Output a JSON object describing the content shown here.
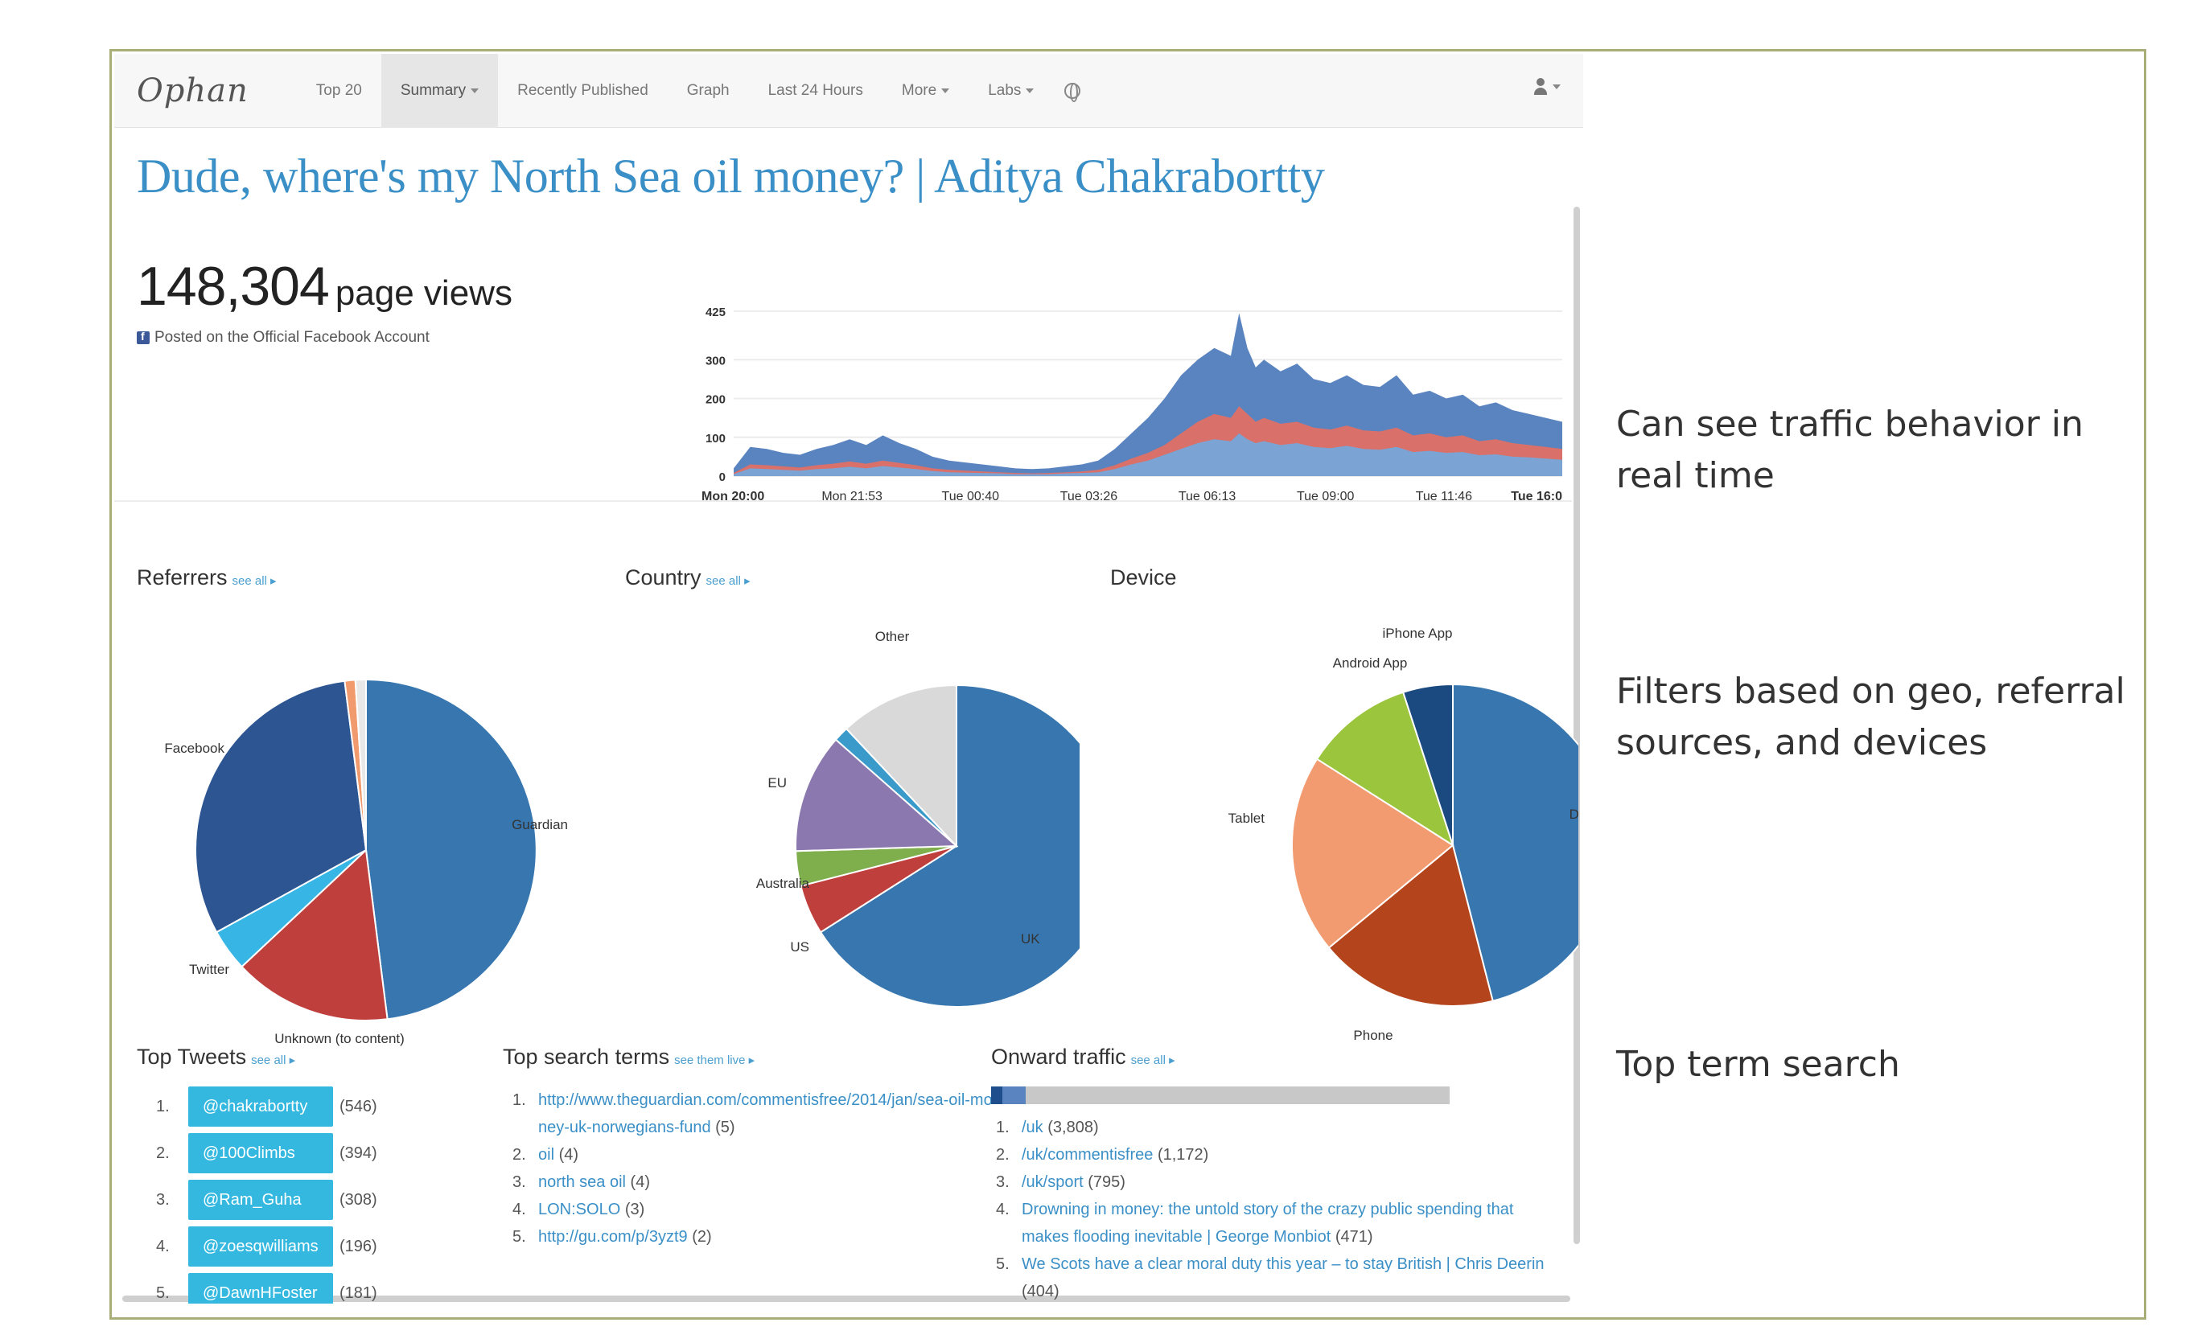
{
  "navbar": {
    "brand": "Ophan",
    "items": [
      {
        "label": "Top 20",
        "active": false,
        "caret": false
      },
      {
        "label": "Summary",
        "active": true,
        "caret": true
      },
      {
        "label": "Recently Published",
        "active": false,
        "caret": false
      },
      {
        "label": "Graph",
        "active": false,
        "caret": false
      },
      {
        "label": "Last 24 Hours",
        "active": false,
        "caret": false
      },
      {
        "label": "More",
        "active": false,
        "caret": true
      },
      {
        "label": "Labs",
        "active": false,
        "caret": true
      }
    ]
  },
  "article": {
    "title": "Dude, where's my North Sea oil money? | Aditya Chakrabortty",
    "page_views": "148,304",
    "page_views_label": "page views",
    "posted_note": "Posted on the Official Facebook Account"
  },
  "chart_data": [
    {
      "type": "area",
      "title": "",
      "y_ticks": [
        "0",
        "100",
        "200",
        "300",
        "425"
      ],
      "ylim": [
        0,
        425
      ],
      "x_ticks": [
        "Mon 20:00",
        "Mon 21:53",
        "Tue 00:40",
        "Tue 03:26",
        "Tue 06:13",
        "Tue 09:00",
        "Tue 11:46",
        "Tue 16:0"
      ],
      "x": [
        0,
        0.02,
        0.04,
        0.06,
        0.08,
        0.1,
        0.12,
        0.14,
        0.16,
        0.18,
        0.2,
        0.22,
        0.24,
        0.26,
        0.28,
        0.3,
        0.32,
        0.34,
        0.36,
        0.38,
        0.4,
        0.42,
        0.44,
        0.46,
        0.48,
        0.5,
        0.52,
        0.54,
        0.56,
        0.58,
        0.6,
        0.61,
        0.62,
        0.63,
        0.64,
        0.66,
        0.68,
        0.7,
        0.72,
        0.74,
        0.76,
        0.78,
        0.8,
        0.82,
        0.84,
        0.86,
        0.88,
        0.9,
        0.92,
        0.94,
        0.96,
        0.98,
        1.0
      ],
      "series": [
        {
          "color": "#5a84c0",
          "values": [
            20,
            75,
            70,
            60,
            55,
            70,
            80,
            95,
            80,
            105,
            85,
            70,
            50,
            40,
            35,
            30,
            25,
            20,
            18,
            20,
            25,
            30,
            40,
            70,
            110,
            150,
            200,
            260,
            300,
            330,
            310,
            420,
            330,
            280,
            300,
            270,
            290,
            250,
            240,
            260,
            235,
            230,
            260,
            210,
            220,
            200,
            210,
            180,
            190,
            170,
            160,
            150,
            140
          ]
        },
        {
          "color": "#d9706a",
          "values": [
            8,
            30,
            28,
            25,
            22,
            28,
            32,
            38,
            32,
            40,
            34,
            28,
            20,
            16,
            14,
            12,
            10,
            8,
            7,
            8,
            10,
            12,
            16,
            28,
            45,
            60,
            80,
            110,
            140,
            160,
            150,
            180,
            160,
            140,
            150,
            135,
            140,
            125,
            120,
            130,
            118,
            115,
            125,
            105,
            110,
            100,
            105,
            90,
            95,
            85,
            80,
            75,
            70
          ]
        },
        {
          "color": "#7ba4d4",
          "values": [
            5,
            20,
            18,
            16,
            14,
            18,
            20,
            24,
            20,
            26,
            22,
            18,
            13,
            10,
            9,
            8,
            7,
            5,
            5,
            5,
            7,
            8,
            10,
            18,
            30,
            40,
            55,
            70,
            85,
            95,
            90,
            110,
            95,
            85,
            90,
            80,
            85,
            75,
            72,
            78,
            70,
            68,
            75,
            62,
            65,
            60,
            62,
            54,
            56,
            50,
            48,
            45,
            42
          ]
        }
      ]
    },
    {
      "type": "pie",
      "title": "Referrers",
      "categories": [
        "Guardian",
        "Unknown (to content)",
        "Twitter",
        "Facebook",
        "",
        ""
      ],
      "values": [
        48,
        15,
        4,
        31,
        1,
        1
      ],
      "colors": [
        "#3776ae",
        "#bf3f3d",
        "#37b5e5",
        "#2c5592",
        "#f19a6d",
        "#e8e8e8"
      ]
    },
    {
      "type": "pie",
      "title": "Country",
      "categories": [
        "UK",
        "US",
        "Australia",
        "EU",
        "",
        "Other"
      ],
      "values": [
        66,
        5,
        3.5,
        12,
        1.5,
        12
      ],
      "colors": [
        "#3776ae",
        "#bf3f3d",
        "#7fae4d",
        "#8a78ae",
        "#3a9ac9",
        "#d9d9d9"
      ]
    },
    {
      "type": "pie",
      "title": "Device",
      "categories": [
        "Desktop",
        "Phone",
        "Tablet",
        "Android App",
        "iPhone App"
      ],
      "values": [
        46,
        18,
        20,
        11,
        5
      ],
      "colors": [
        "#3776ae",
        "#b3441c",
        "#f39b70",
        "#9bc53d",
        "#1a4a80"
      ]
    }
  ],
  "referrers": {
    "title": "Referrers",
    "see_all": "see all ▸"
  },
  "country": {
    "title": "Country",
    "see_all": "see all ▸"
  },
  "device": {
    "title": "Device"
  },
  "top_tweets": {
    "title": "Top Tweets",
    "see_all": "see all ▸",
    "items": [
      {
        "num": "1.",
        "handle": "@chakrabortty",
        "count": "(546)"
      },
      {
        "num": "2.",
        "handle": "@100Climbs",
        "count": "(394)"
      },
      {
        "num": "3.",
        "handle": "@Ram_Guha",
        "count": "(308)"
      },
      {
        "num": "4.",
        "handle": "@zoesqwilliams",
        "count": "(196)"
      },
      {
        "num": "5.",
        "handle": "@DawnHFoster",
        "count": "(181)"
      }
    ]
  },
  "top_search": {
    "title": "Top search terms",
    "see_all": "see them live ▸",
    "items": [
      {
        "num": "1.",
        "term": "http://www.theguardian.com/commentisfree/2014/jan/sea-oil-money-uk-norwegians-fund",
        "count": "(5)"
      },
      {
        "num": "2.",
        "term": "oil",
        "count": "(4)"
      },
      {
        "num": "3.",
        "term": "north sea oil",
        "count": "(4)"
      },
      {
        "num": "4.",
        "term": "LON:SOLO",
        "count": "(3)"
      },
      {
        "num": "5.",
        "term": "http://gu.com/p/3yzt9",
        "count": "(2)"
      }
    ]
  },
  "onward": {
    "title": "Onward traffic",
    "see_all": "see all ▸",
    "bar_dark_fraction": 0.025,
    "bar_mid_fraction": 0.05,
    "items": [
      {
        "num": "1.",
        "link": "/uk",
        "count": "(3,808)"
      },
      {
        "num": "2.",
        "link": "/uk/commentisfree",
        "count": "(1,172)"
      },
      {
        "num": "3.",
        "link": "/uk/sport",
        "count": "(795)"
      },
      {
        "num": "4.",
        "link": "Drowning in money: the untold story of the crazy public spending that makes flooding inevitable | George Monbiot",
        "count": "(471)"
      },
      {
        "num": "5.",
        "link": "We Scots have a clear moral duty this year – to stay British | Chris Deerin",
        "count": "(404)"
      }
    ]
  },
  "annotations": {
    "traffic": "Can see traffic behavior in real time",
    "filters": "Filters based on geo, referral sources, and devices",
    "search": "Top term search"
  }
}
